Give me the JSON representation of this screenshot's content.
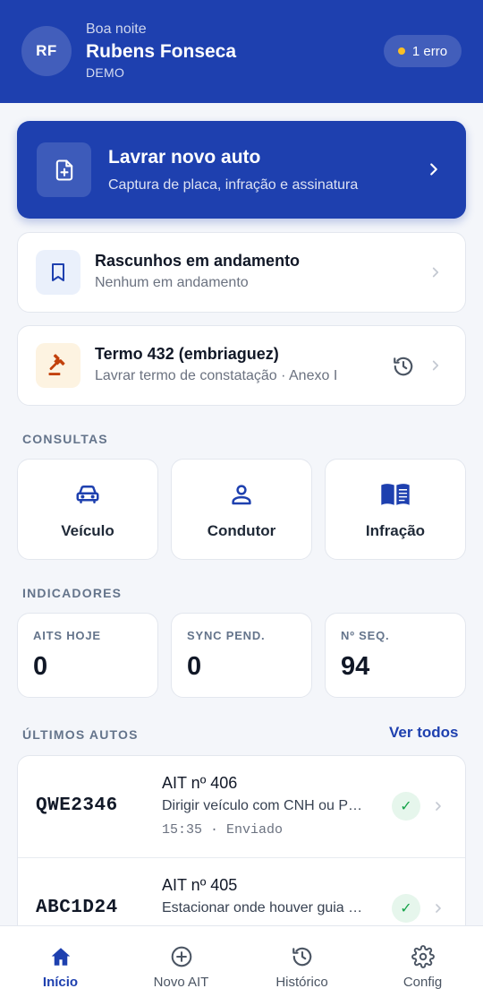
{
  "header": {
    "avatar_initials": "RF",
    "greeting": "Boa noite",
    "user_name": "Rubens Fonseca",
    "environment": "DEMO",
    "error_badge": "1 erro",
    "colors": {
      "background": "#1e40af",
      "error_dot": "#fbbf24"
    }
  },
  "primary_action": {
    "title": "Lavrar novo auto",
    "subtitle": "Captura de placa, infração e assinatura",
    "icon": "file-plus-icon"
  },
  "drafts": {
    "title": "Rascunhos em andamento",
    "subtitle": "Nenhum em andamento",
    "icon": "bookmark-icon"
  },
  "termo": {
    "title": "Termo 432 (embriaguez)",
    "subtitle": "Lavrar termo de constatação · Anexo I",
    "icon": "gavel-icon",
    "secondary_icon": "history-icon"
  },
  "consultas": {
    "label": "CONSULTAS",
    "items": [
      {
        "label": "Veículo",
        "icon": "car-icon"
      },
      {
        "label": "Condutor",
        "icon": "person-icon"
      },
      {
        "label": "Infração",
        "icon": "book-icon"
      }
    ]
  },
  "indicadores": {
    "label": "INDICADORES",
    "items": [
      {
        "label": "AITS HOJE",
        "value": "0"
      },
      {
        "label": "SYNC PEND.",
        "value": "0"
      },
      {
        "label": "Nº SEQ.",
        "value": "94"
      }
    ]
  },
  "recent": {
    "label": "ÚLTIMOS AUTOS",
    "see_all": "Ver todos",
    "items": [
      {
        "plate": "QWE2346",
        "title": "AIT nº 406",
        "description": "Dirigir veículo com CNH ou P…",
        "meta": "15:35 · Enviado",
        "status": "✓"
      },
      {
        "plate": "ABC1D24",
        "title": "AIT nº 405",
        "description": "Estacionar onde houver guia …",
        "meta": "",
        "status": "✓"
      }
    ]
  },
  "nav": {
    "items": [
      {
        "label": "Início",
        "icon": "home-icon",
        "active": true
      },
      {
        "label": "Novo AIT",
        "icon": "plus-circle-icon",
        "active": false
      },
      {
        "label": "Histórico",
        "icon": "history-icon",
        "active": false
      },
      {
        "label": "Config",
        "icon": "gear-icon",
        "active": false
      }
    ],
    "active_color": "#1e40af"
  }
}
